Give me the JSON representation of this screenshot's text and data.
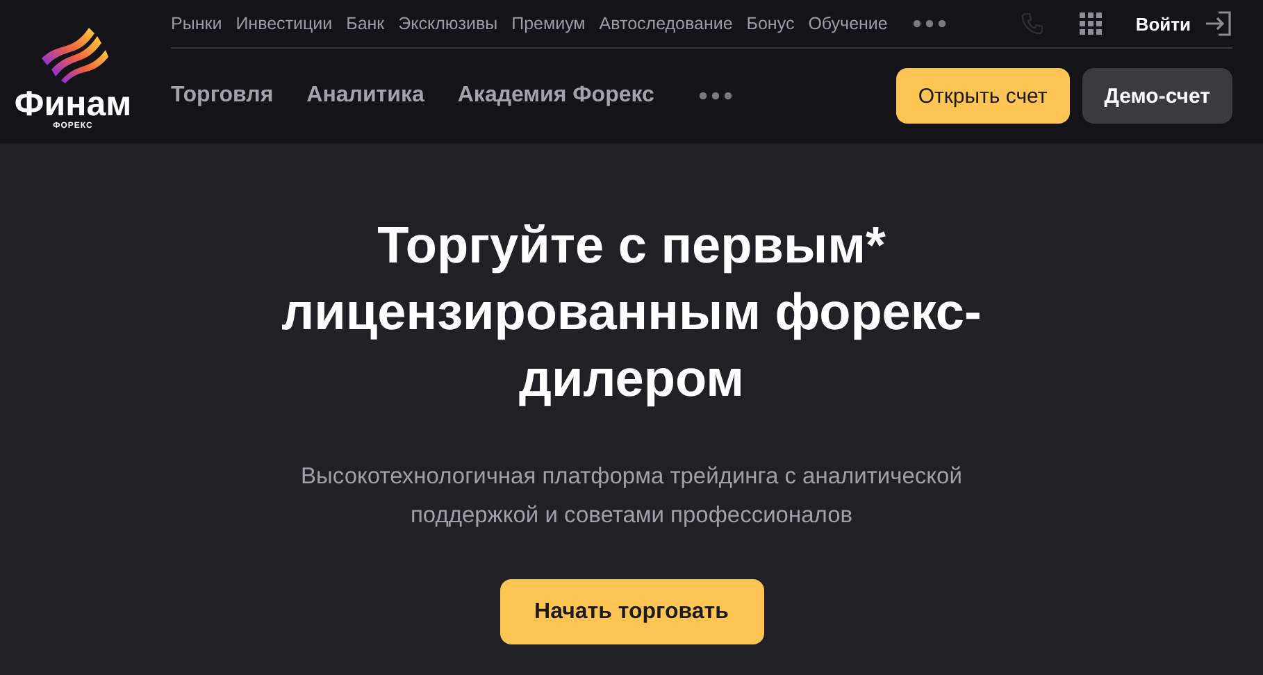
{
  "logo": {
    "name": "Финам",
    "subtitle": "ФОРЕКС"
  },
  "top_nav": [
    "Рынки",
    "Инвестиции",
    "Банк",
    "Эксклюзивы",
    "Премиум",
    "Автоследование",
    "Бонус",
    "Обучение"
  ],
  "login": "Войти",
  "main_nav": [
    "Торговля",
    "Аналитика",
    "Академия Форекс"
  ],
  "buttons": {
    "open_account": "Открыть счет",
    "demo_account": "Демо-счет"
  },
  "hero": {
    "title": "Торгуйте с первым* лицензированным форекс-дилером",
    "subtitle": "Высокотехнологичная платформа трейдинга с аналитической поддержкой и советами профессионалов",
    "cta": "Начать торговать"
  }
}
